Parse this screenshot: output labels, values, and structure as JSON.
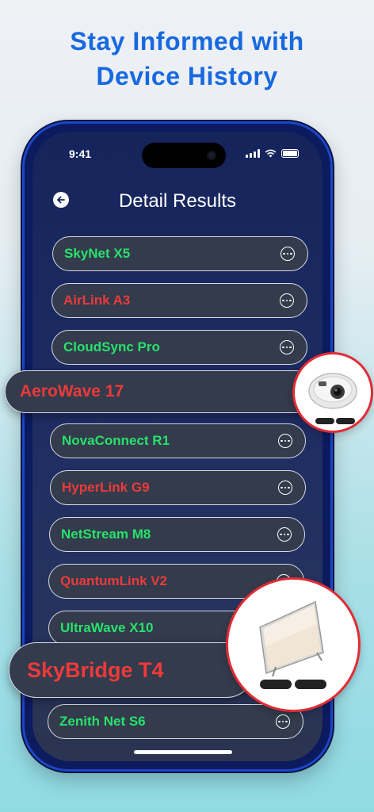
{
  "headline": {
    "line1": "Stay Informed with",
    "line2": "Device History"
  },
  "status_bar": {
    "time": "9:41"
  },
  "header": {
    "title": "Detail Results"
  },
  "devices": [
    {
      "name": "SkyNet X5",
      "status_color": "#27e26b"
    },
    {
      "name": "AirLink A3",
      "status_color": "#ee3a3a"
    },
    {
      "name": "CloudSync Pro",
      "status_color": "#27e26b"
    },
    {
      "name": "AeroWave 17",
      "status_color": "#ee3a3a"
    },
    {
      "name": "NovaConnect R1",
      "status_color": "#27e26b"
    },
    {
      "name": "HyperLink G9",
      "status_color": "#ee3a3a"
    },
    {
      "name": "NetStream M8",
      "status_color": "#27e26b"
    },
    {
      "name": "QuantumLink V2",
      "status_color": "#ee3a3a"
    },
    {
      "name": "UltraWave X10",
      "status_color": "#27e26b"
    },
    {
      "name": "SkyBridge T4",
      "status_color": "#ee3a3a"
    },
    {
      "name": "Zenith Net S6",
      "status_color": "#27e26b"
    }
  ],
  "callouts": {
    "camera": {
      "icon": "security-camera-image"
    },
    "tv": {
      "icon": "television-image"
    }
  },
  "colors": {
    "accent": "#1769e0",
    "safe": "#27e26b",
    "unsafe": "#ee3a3a",
    "highlight_border": "#e12c35"
  }
}
